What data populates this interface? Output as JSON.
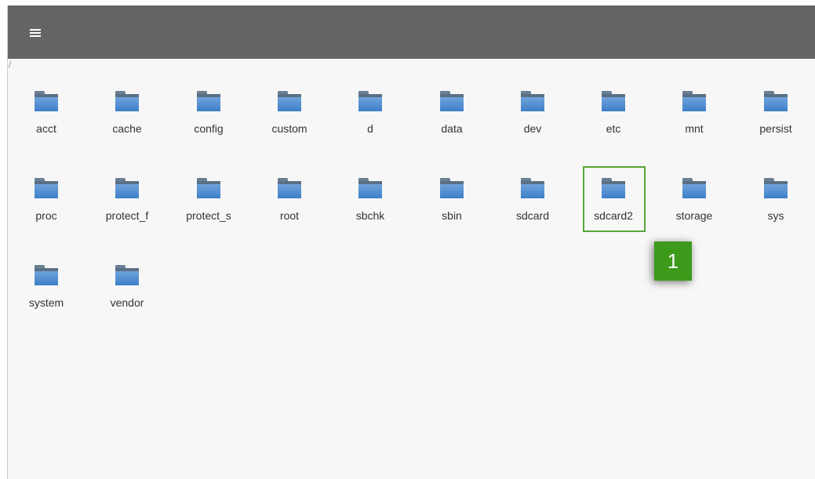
{
  "path": "/",
  "icons": {
    "menu": "hamburger-menu-icon",
    "folder": "folder-icon"
  },
  "colors": {
    "app_bar": "#646464",
    "background": "#f7f7f7",
    "highlight": "#56a63a",
    "marker": "#3d9a1a"
  },
  "folders": [
    {
      "label": "acct"
    },
    {
      "label": "cache"
    },
    {
      "label": "config"
    },
    {
      "label": "custom"
    },
    {
      "label": "d"
    },
    {
      "label": "data"
    },
    {
      "label": "dev"
    },
    {
      "label": "etc"
    },
    {
      "label": "mnt"
    },
    {
      "label": "persist"
    },
    {
      "label": "proc"
    },
    {
      "label": "protect_f"
    },
    {
      "label": "protect_s"
    },
    {
      "label": "root"
    },
    {
      "label": "sbchk"
    },
    {
      "label": "sbin"
    },
    {
      "label": "sdcard"
    },
    {
      "label": "sdcard2"
    },
    {
      "label": "storage"
    },
    {
      "label": "sys"
    },
    {
      "label": "system"
    },
    {
      "label": "vendor"
    }
  ],
  "annotation": {
    "marker_label": "1",
    "highlighted_folder": "sdcard2"
  }
}
